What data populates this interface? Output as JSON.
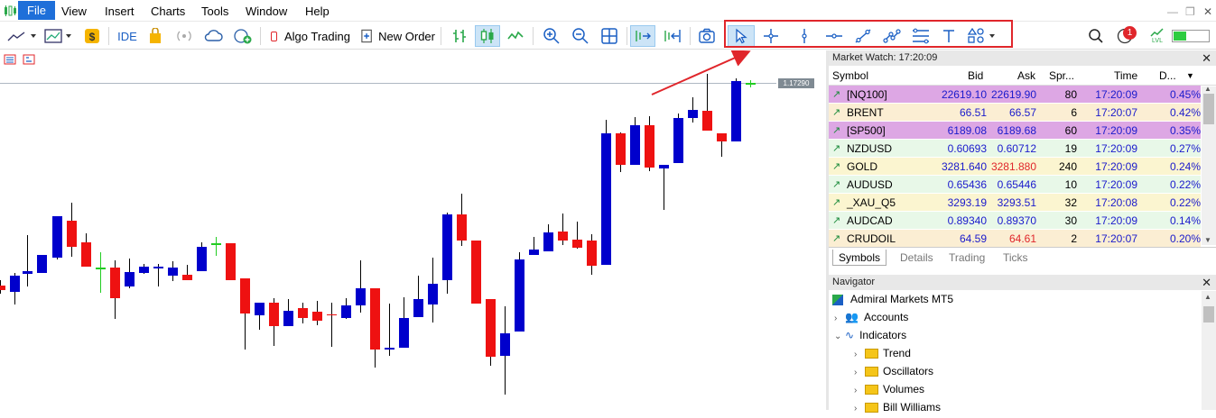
{
  "menu": {
    "file": "File",
    "view": "View",
    "insert": "Insert",
    "charts": "Charts",
    "tools": "Tools",
    "window": "Window",
    "help": "Help"
  },
  "toolbar": {
    "ide": "IDE",
    "algo_trading": "Algo Trading",
    "new_order": "New Order",
    "notification_count": "1",
    "level_label": "LVL"
  },
  "chart": {
    "current_price": "1.17290"
  },
  "market_watch": {
    "title": "Market Watch: 17:20:09",
    "columns": [
      "Symbol",
      "Bid",
      "Ask",
      "Spr...",
      "Time",
      "D..."
    ],
    "rows": [
      {
        "symbol": "[NQ100]",
        "bid": "22619.10",
        "ask": "22619.90",
        "spread": "80",
        "time": "17:20:09",
        "change": "0.45%",
        "bg": "#dda7e4"
      },
      {
        "symbol": "BRENT",
        "bid": "66.51",
        "ask": "66.57",
        "spread": "6",
        "time": "17:20:07",
        "change": "0.42%",
        "bg": "#fbeed3"
      },
      {
        "symbol": "[SP500]",
        "bid": "6189.08",
        "ask": "6189.68",
        "spread": "60",
        "time": "17:20:09",
        "change": "0.35%",
        "bg": "#dda7e4"
      },
      {
        "symbol": "NZDUSD",
        "bid": "0.60693",
        "ask": "0.60712",
        "spread": "19",
        "time": "17:20:09",
        "change": "0.27%",
        "bg": "#e8f8e8"
      },
      {
        "symbol": "GOLD",
        "bid": "3281.640",
        "ask": "3281.880",
        "spread": "240",
        "time": "17:20:09",
        "change": "0.24%",
        "bg": "#fbf5d0",
        "ask_color": "#e0262b"
      },
      {
        "symbol": "AUDUSD",
        "bid": "0.65436",
        "ask": "0.65446",
        "spread": "10",
        "time": "17:20:09",
        "change": "0.22%",
        "bg": "#e8f8e8"
      },
      {
        "symbol": "_XAU_Q5",
        "bid": "3293.19",
        "ask": "3293.51",
        "spread": "32",
        "time": "17:20:08",
        "change": "0.22%",
        "bg": "#fbf5d0"
      },
      {
        "symbol": "AUDCAD",
        "bid": "0.89340",
        "ask": "0.89370",
        "spread": "30",
        "time": "17:20:09",
        "change": "0.14%",
        "bg": "#e8f8e8"
      },
      {
        "symbol": "CRUDOIL",
        "bid": "64.59",
        "ask": "64.61",
        "spread": "2",
        "time": "17:20:07",
        "change": "0.20%",
        "bg": "#fbeed3",
        "ask_color": "#e0262b"
      }
    ],
    "tabs": [
      "Symbols",
      "Details",
      "Trading",
      "Ticks"
    ]
  },
  "navigator": {
    "title": "Navigator",
    "root": "Admiral Markets MT5",
    "accounts": "Accounts",
    "indicators": "Indicators",
    "folders": [
      "Trend",
      "Oscillators",
      "Volumes",
      "Bill Williams"
    ]
  },
  "colors": {
    "bull": "#0000cc",
    "bear": "#ee1111",
    "doji": "#22cc22",
    "annotation": "#e0262b",
    "accent": "#1e6fd9"
  }
}
